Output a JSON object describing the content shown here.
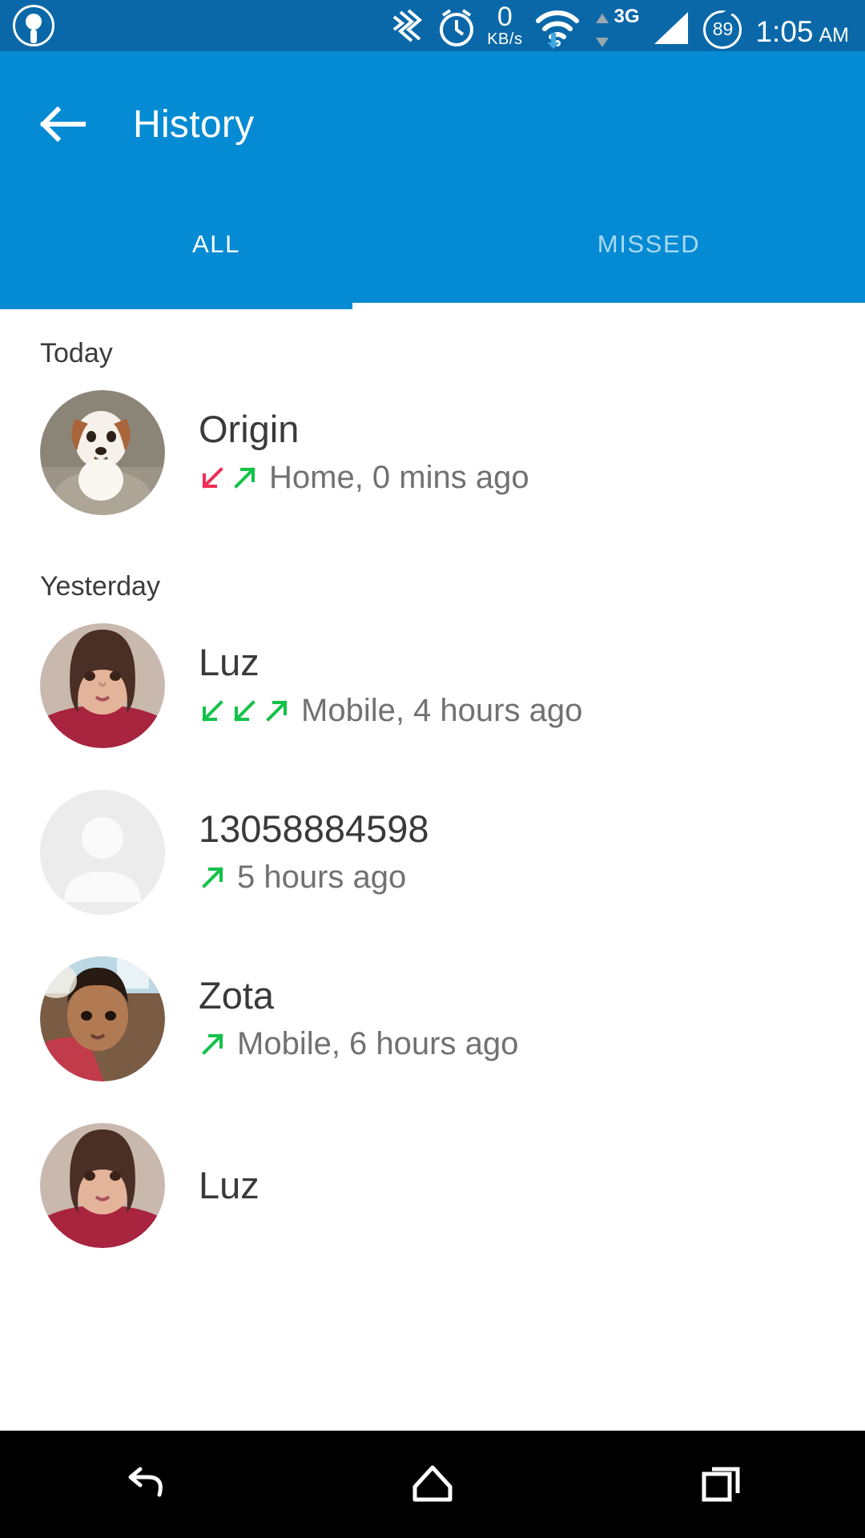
{
  "status_bar": {
    "logo_icon": "steering-wheel-icon",
    "vibrate_icon": "vibrate-icon",
    "alarm_icon": "alarm-clock-icon",
    "data_rate_value": "0",
    "data_rate_unit": "KB/s",
    "wifi_icon": "wifi-icon",
    "data_transfer_icon": "data-transfer-arrows-icon",
    "network_type": "3G",
    "signal_icon": "signal-bars-icon",
    "battery_level": "89",
    "time": "1:05",
    "time_period": "AM"
  },
  "app_bar": {
    "back_icon": "back-arrow-icon",
    "title": "History"
  },
  "tabs": [
    {
      "label": "ALL",
      "active": true
    },
    {
      "label": "MISSED",
      "active": false
    }
  ],
  "colors": {
    "status_bar_bg": "#0a68a8",
    "app_bar_bg": "#058bd3",
    "accent": "#058bd3",
    "missed_arrow": "#ef2d56",
    "call_arrow": "#13c24a",
    "name_text": "#3a3a3a",
    "detail_text": "#717171",
    "nav_bar_bg": "#000000"
  },
  "sections": [
    {
      "header": "Today",
      "items": [
        {
          "name": "Origin",
          "detail": "Home, 0 mins ago",
          "avatar_type": "photo-dog",
          "arrows": [
            "missed",
            "outgoing"
          ]
        }
      ]
    },
    {
      "header": "Yesterday",
      "items": [
        {
          "name": "Luz",
          "detail": "Mobile, 4 hours ago",
          "avatar_type": "photo-woman-1",
          "arrows": [
            "incoming",
            "incoming",
            "outgoing"
          ]
        },
        {
          "name": "13058884598",
          "detail": "5 hours ago",
          "avatar_type": "placeholder",
          "arrows": [
            "outgoing"
          ]
        },
        {
          "name": "Zota",
          "detail": "Mobile, 6 hours ago",
          "avatar_type": "photo-woman-2",
          "arrows": [
            "outgoing"
          ]
        },
        {
          "name": "Luz",
          "detail": "",
          "avatar_type": "photo-woman-1",
          "arrows": []
        }
      ]
    }
  ],
  "nav_bar": {
    "back_label": "back-nav-icon",
    "home_label": "home-nav-icon",
    "recents_label": "recents-nav-icon"
  }
}
